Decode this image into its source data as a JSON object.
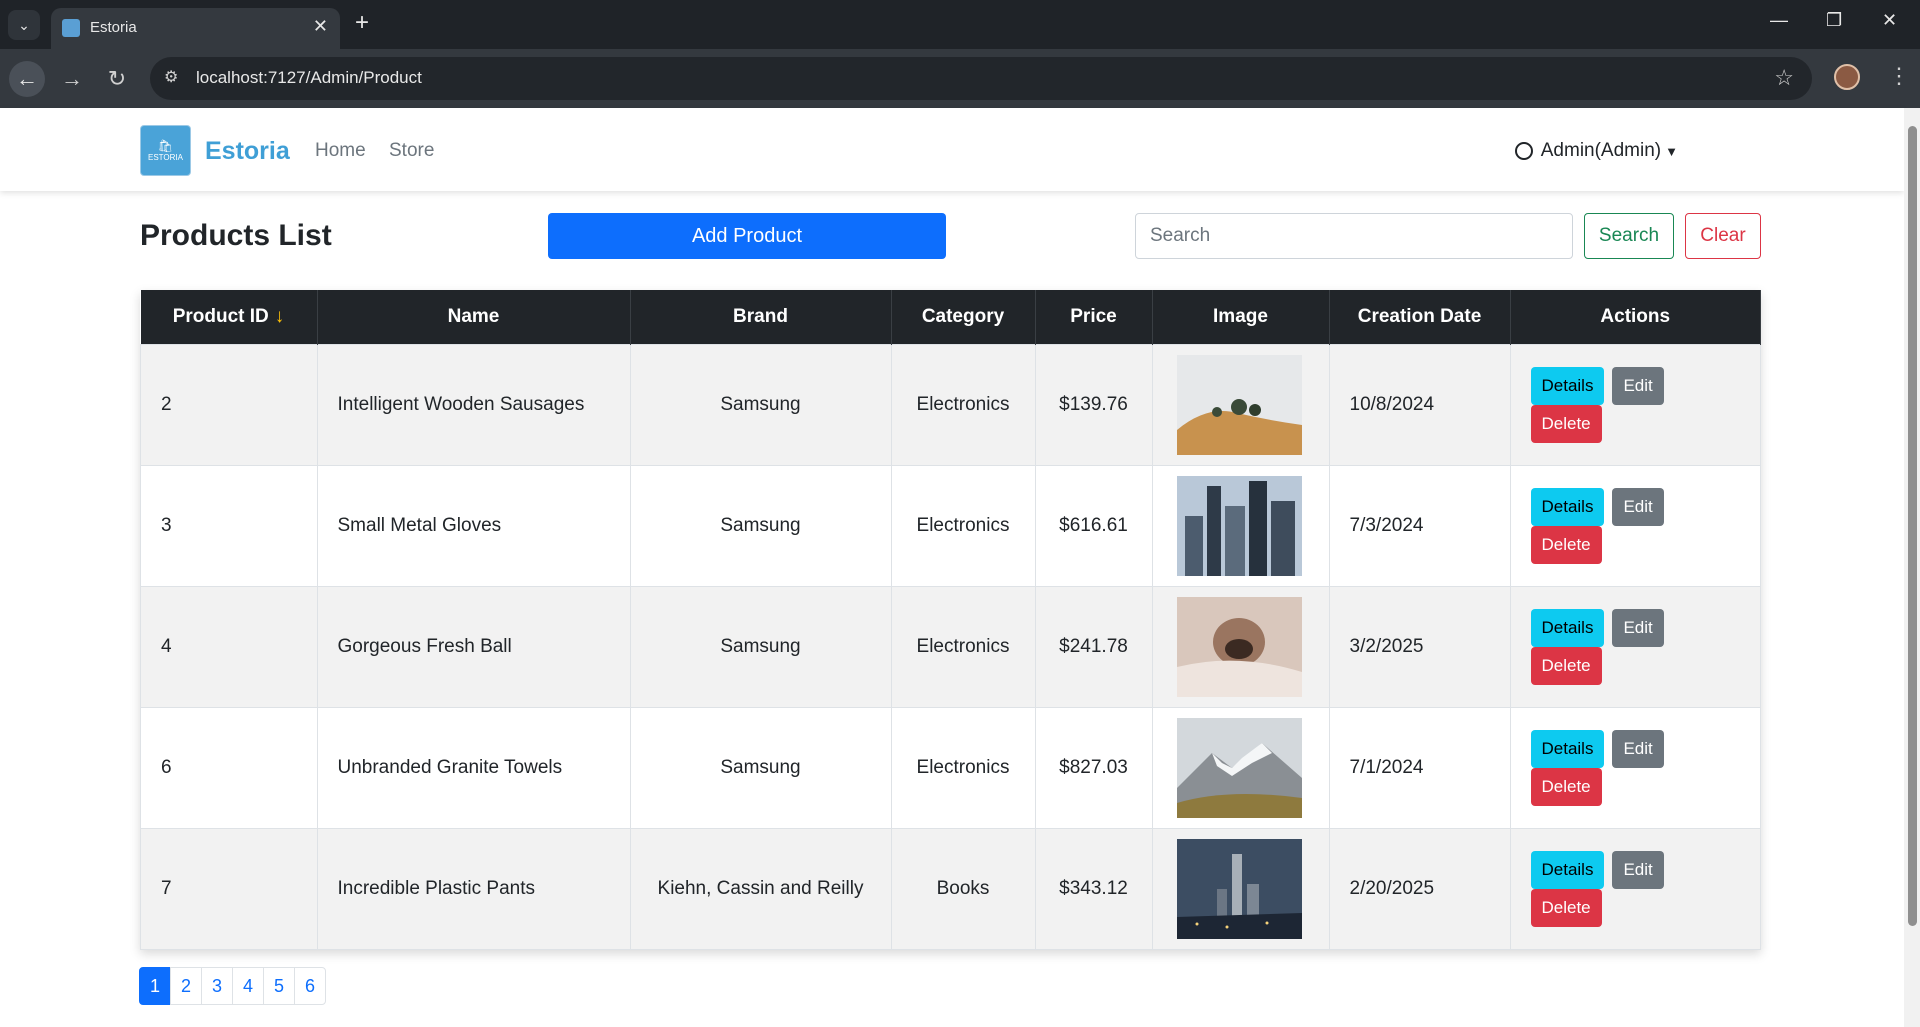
{
  "browser": {
    "tab_title": "Estoria",
    "url": "localhost:7127/Admin/Product"
  },
  "navbar": {
    "brand": "Estoria",
    "logo_text": "ESTORIA",
    "links": [
      "Home",
      "Store"
    ],
    "user": "Admin(Admin)"
  },
  "main": {
    "heading": "Products List",
    "add_button": "Add Product",
    "search_placeholder": "Search",
    "search_button": "Search",
    "clear_button": "Clear"
  },
  "table": {
    "headers": [
      "Product ID",
      "Name",
      "Brand",
      "Category",
      "Price",
      "Image",
      "Creation Date",
      "Actions"
    ],
    "sort_icon": "arrow-down-icon",
    "rows": [
      {
        "id": "2",
        "name": "Intelligent Wooden Sausages",
        "brand": "Samsung",
        "category": "Electronics",
        "price": "$139.76",
        "image": "foggy-hill",
        "date": "10/8/2024"
      },
      {
        "id": "3",
        "name": "Small Metal Gloves",
        "brand": "Samsung",
        "category": "Electronics",
        "price": "$616.61",
        "image": "city-skyline",
        "date": "7/3/2024"
      },
      {
        "id": "4",
        "name": "Gorgeous Fresh Ball",
        "brand": "Samsung",
        "category": "Electronics",
        "price": "$241.78",
        "image": "dog-blanket",
        "date": "3/2/2025"
      },
      {
        "id": "6",
        "name": "Unbranded Granite Towels",
        "brand": "Samsung",
        "category": "Electronics",
        "price": "$827.03",
        "image": "snowy-mountain",
        "date": "7/1/2024"
      },
      {
        "id": "7",
        "name": "Incredible Plastic Pants",
        "brand": "Kiehn, Cassin and Reilly",
        "category": "Books",
        "price": "$343.12",
        "image": "city-night",
        "date": "2/20/2025"
      }
    ],
    "actions": {
      "details": "Details",
      "edit": "Edit",
      "delete": "Delete"
    }
  },
  "pagination": {
    "pages": [
      "1",
      "2",
      "3",
      "4",
      "5",
      "6"
    ],
    "current": "1"
  },
  "colors": {
    "primary": "#0d6efd",
    "info": "#0dcaf0",
    "secondary": "#6c757d",
    "danger": "#dc3545",
    "success": "#198754",
    "brand": "#3f9fd6"
  }
}
